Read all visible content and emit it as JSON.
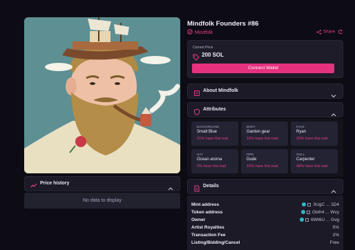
{
  "nft": {
    "title": "Mindfolk Founders #86",
    "collection": "Mindfolk",
    "share_label": "Share"
  },
  "price": {
    "label": "Current Price",
    "value": "200 SOL",
    "button": "Connect Wallet"
  },
  "price_history": {
    "title": "Price history",
    "empty": "No data to display"
  },
  "about": {
    "title": "About Mindfolk"
  },
  "attributes": {
    "title": "Attributes",
    "items": [
      {
        "key": "BACKGROUND",
        "value": "Smalt Blue",
        "pct": "21% have this trait"
      },
      {
        "key": "BODY",
        "value": "Garden gear",
        "pct": "16% have this trait"
      },
      {
        "key": "FACE",
        "value": "Ryan",
        "pct": "20% have this trait"
      },
      {
        "key": "HAT",
        "value": "Ocean aroma",
        "pct": "5% have this trait"
      },
      {
        "key": "PIPE",
        "value": "Dude",
        "pct": "15% have this trait"
      },
      {
        "key": "SKILL",
        "value": "Carpenter",
        "pct": "48% have this trait"
      }
    ]
  },
  "details": {
    "title": "Details",
    "rows": [
      {
        "key": "Mint address",
        "value": "3UgC ... 1D4"
      },
      {
        "key": "Token address",
        "value": "Gbih4 ... Wvy"
      },
      {
        "key": "Owner",
        "value": "6Wt6U ... Gvg"
      },
      {
        "key": "Artist Royalties",
        "value": "5%"
      },
      {
        "key": "Transaction Fee",
        "value": "2%"
      },
      {
        "key": "Listing/Bidding/Cancel",
        "value": "Free"
      }
    ]
  },
  "colors": {
    "accent": "#e6317f",
    "background": "#0d0c14",
    "panel": "#1b1a26"
  }
}
